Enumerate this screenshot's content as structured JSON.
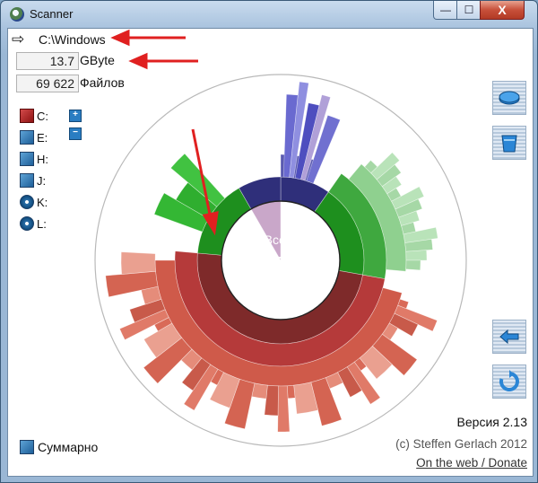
{
  "window": {
    "title": "Scanner"
  },
  "titlebar": {
    "minimize": "—",
    "maximize": "☐",
    "close": "X"
  },
  "path": {
    "value": "C:\\Windows"
  },
  "size": {
    "value": "13.7",
    "unit": "GByte"
  },
  "files": {
    "value": "69 622",
    "unit": "Файлов"
  },
  "drives": [
    {
      "label": "C:",
      "icon": "hard-drive-icon",
      "selected": true
    },
    {
      "label": "E:",
      "icon": "hard-drive-icon"
    },
    {
      "label": "H:",
      "icon": "hard-drive-icon"
    },
    {
      "label": "J:",
      "icon": "hard-drive-icon"
    },
    {
      "label": "K:",
      "icon": "cd-drive-icon"
    },
    {
      "label": "L:",
      "icon": "cd-drive-icon"
    }
  ],
  "drive_buttons": {
    "up": "+",
    "down": "−"
  },
  "tools": [
    {
      "name": "disk-tool-button",
      "icon": "disk-icon"
    },
    {
      "name": "trash-tool-button",
      "icon": "trash-icon"
    },
    {
      "name": "back-button",
      "icon": "back-arrow-icon"
    },
    {
      "name": "refresh-button",
      "icon": "refresh-icon"
    }
  ],
  "center": {
    "label": "Всего",
    "value": "132",
    "unit": "GByte"
  },
  "summary": {
    "label": "Суммарно"
  },
  "footer": {
    "version": "Версия 2.13",
    "copyright": "(c) Steffen Gerlach 2012",
    "link": "On the web / Donate"
  },
  "colors": {
    "accent_red": "#e02020",
    "titlebar": "#a9c3de",
    "center_fill": "#6b6b8c",
    "green": "#1e8f1e",
    "dark_red": "#7e2a2a",
    "navy": "#2f2f7a"
  }
}
